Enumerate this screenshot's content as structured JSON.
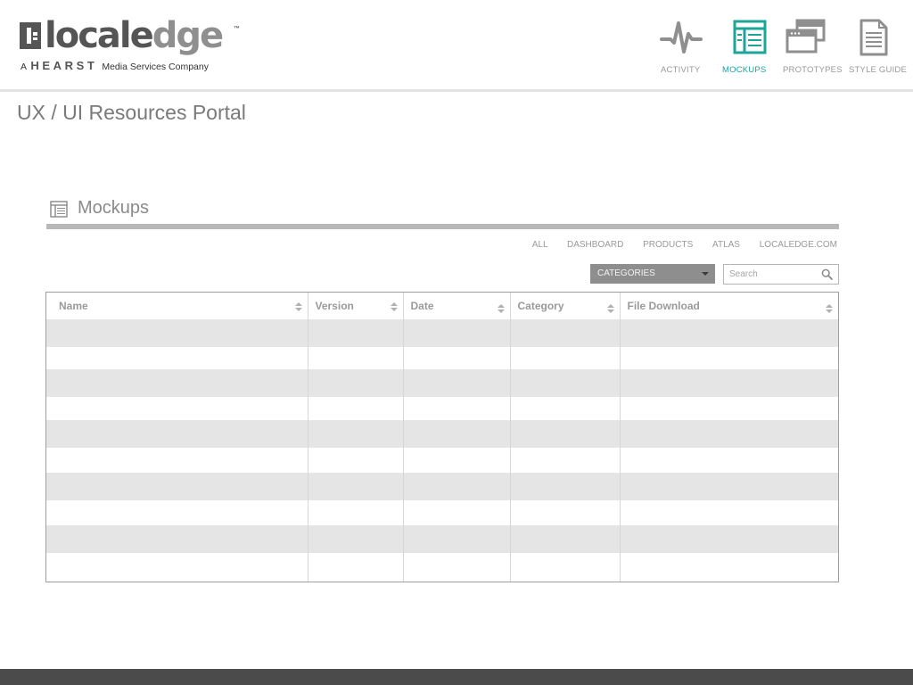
{
  "brand": {
    "word_part1": "locale",
    "word_part2": "dge",
    "trademark": "™",
    "tag_prefix": "A",
    "tag_brand": "HEARST",
    "tag_suffix": "Media Services Company"
  },
  "nav": {
    "items": [
      {
        "label": "ACTIVITY",
        "icon": "activity-pulse-icon",
        "active": false
      },
      {
        "label": "MOCKUPS",
        "icon": "mockup-layout-icon",
        "active": true
      },
      {
        "label": "PROTOTYPES",
        "icon": "prototype-windows-icon",
        "active": false
      },
      {
        "label": "STYLE GUIDE",
        "icon": "document-icon",
        "active": false
      }
    ]
  },
  "page": {
    "title": "UX / UI Resources Portal"
  },
  "panel": {
    "title": "Mockups",
    "icon": "mockup-layout-icon",
    "filters": [
      "ALL",
      "DASHBOARD",
      "PRODUCTS",
      "ATLAS",
      "LOCALEDGE.COM"
    ],
    "categories_label": "CATEGORIES",
    "search_placeholder": "Search",
    "search_value": ""
  },
  "table": {
    "columns": [
      "Name",
      "Version",
      "Date",
      "Category",
      "File Download"
    ],
    "rows": [
      [
        "",
        "",
        "",
        "",
        ""
      ],
      [
        "",
        "",
        "",
        "",
        ""
      ],
      [
        "",
        "",
        "",
        "",
        ""
      ],
      [
        "",
        "",
        "",
        "",
        ""
      ],
      [
        "",
        "",
        "",
        "",
        ""
      ],
      [
        "",
        "",
        "",
        "",
        ""
      ],
      [
        "",
        "",
        "",
        "",
        ""
      ],
      [
        "",
        "",
        "",
        "",
        ""
      ],
      [
        "",
        "",
        "",
        "",
        ""
      ],
      [
        "",
        "",
        "",
        "",
        ""
      ]
    ]
  },
  "colors": {
    "accent": "#1da59a",
    "nav_inactive": "#999999",
    "rule": "#b8b8b8",
    "row_stripe": "#e5e5e5",
    "footer": "#4b4b4b"
  }
}
